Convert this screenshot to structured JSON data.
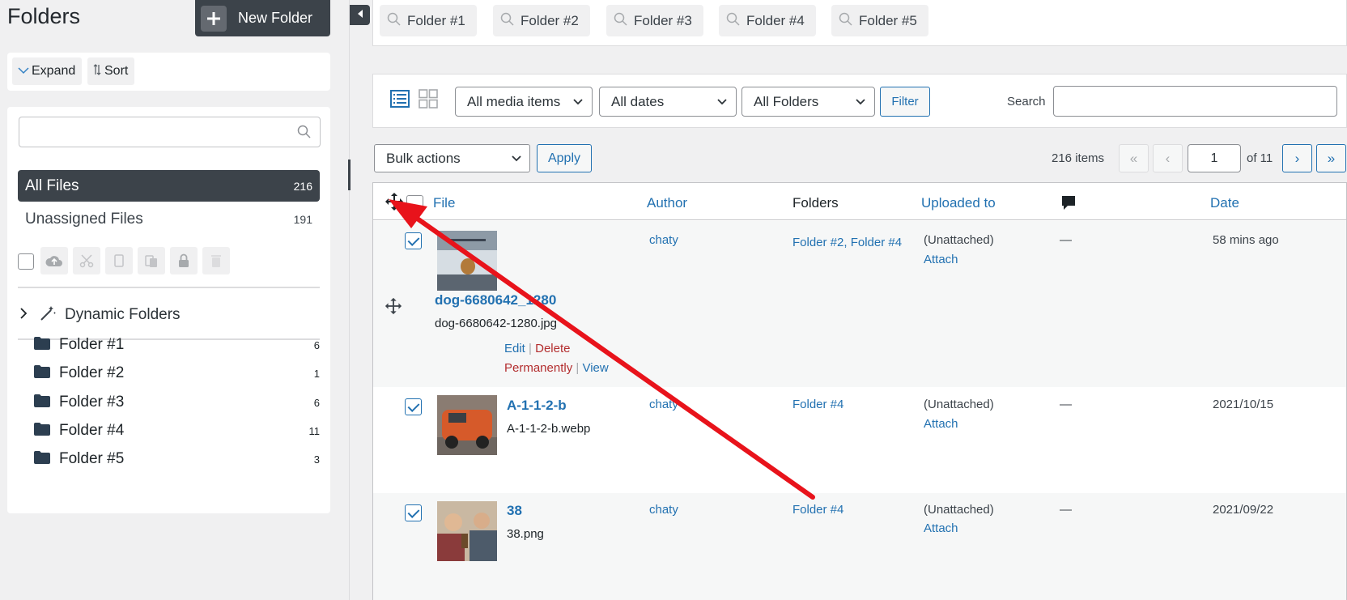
{
  "sidebar": {
    "title": "Folders",
    "new_folder_label": "New Folder",
    "expand_label": "Expand",
    "sort_label": "Sort",
    "search_placeholder": "",
    "all_files": {
      "label": "All Files",
      "count": "216"
    },
    "unassigned": {
      "label": "Unassigned Files",
      "count": "191"
    },
    "dynamic_folders_label": "Dynamic Folders",
    "folders": [
      {
        "label": "Folder #1",
        "count": "6"
      },
      {
        "label": "Folder #2",
        "count": "1"
      },
      {
        "label": "Folder #3",
        "count": "6"
      },
      {
        "label": "Folder #4",
        "count": "11"
      },
      {
        "label": "Folder #5",
        "count": "3"
      }
    ]
  },
  "chips": [
    "Folder #1",
    "Folder #2",
    "Folder #3",
    "Folder #4",
    "Folder #5"
  ],
  "filters": {
    "media_type": "All media items",
    "dates": "All dates",
    "folders": "All Folders",
    "filter_label": "Filter",
    "search_label": "Search",
    "search_value": ""
  },
  "bulk": {
    "selected": "Bulk actions",
    "apply_label": "Apply"
  },
  "pagination": {
    "items": "216 items",
    "first": "«",
    "prev": "‹",
    "next": "›",
    "last": "»",
    "current_page": "1",
    "of_pages": "of 11"
  },
  "table": {
    "columns": {
      "file": "File",
      "author": "Author",
      "folders": "Folders",
      "uploaded_to": "Uploaded to",
      "date": "Date"
    },
    "rows": [
      {
        "title": "dog-6680642_1280",
        "filename": "dog-6680642-1280.jpg",
        "author": "chaty",
        "folders": "Folder #2, Folder #4",
        "uploaded": "(Unattached)",
        "attach": "Attach",
        "comments": "—",
        "date": "58 mins ago",
        "checked": true,
        "actions": {
          "edit": "Edit",
          "delete": "Delete Permanently",
          "view": "View",
          "sep": "|"
        }
      },
      {
        "title": "A-1-1-2-b",
        "filename": "A-1-1-2-b.webp",
        "author": "chaty",
        "folders": "Folder #4",
        "uploaded": "(Unattached)",
        "attach": "Attach",
        "comments": "—",
        "date": "2021/10/15",
        "checked": true
      },
      {
        "title": "38",
        "filename": "38.png",
        "author": "chaty",
        "folders": "Folder #4",
        "uploaded": "(Unattached)",
        "attach": "Attach",
        "comments": "—",
        "date": "2021/09/22",
        "checked": true
      }
    ]
  },
  "colors": {
    "accent": "#2271b1",
    "dark": "#3c434a",
    "danger": "#b32d2e",
    "annotation_arrow": "#e8131b",
    "folder_icon": "#2c3e50"
  },
  "icons": [
    "plus-icon",
    "collapse-arrow-icon",
    "chevron-down-icon",
    "sort-icon",
    "search-icon",
    "folder-icon",
    "wand-icon",
    "chevron-right-icon",
    "cloud-upload-icon",
    "scissors-icon",
    "copy-icon",
    "paste-icon",
    "lock-icon",
    "trash-icon",
    "list-view-icon",
    "grid-view-icon",
    "move-icon",
    "comment-icon"
  ]
}
